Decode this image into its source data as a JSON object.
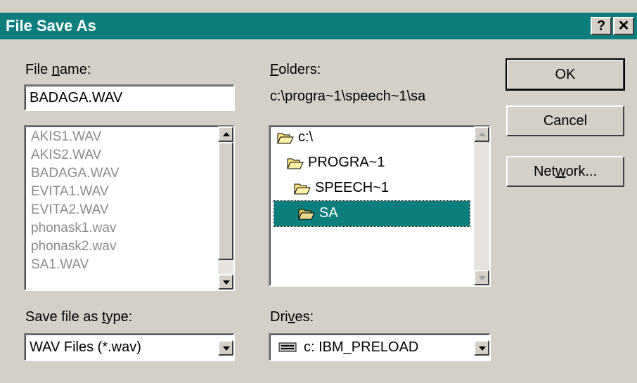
{
  "window": {
    "title": "File Save As",
    "help_label": "?",
    "close_label": "✕"
  },
  "file_name": {
    "label_pre": "File ",
    "label_u": "n",
    "label_post": "ame:",
    "value": "BADAGA.WAV"
  },
  "files": [
    "AKIS1.WAV",
    "AKIS2.WAV",
    "BADAGA.WAV",
    "EVITA1.WAV",
    "EVITA2.WAV",
    "phonask1.wav",
    "phonask2.wav",
    "SA1.WAV"
  ],
  "folders": {
    "label_u": "F",
    "label_post": "olders:",
    "path": "c:\\progra~1\\speech~1\\sa",
    "items": [
      {
        "name": "c:\\",
        "state": "open"
      },
      {
        "name": "PROGRA~1",
        "state": "open"
      },
      {
        "name": "SPEECH~1",
        "state": "open"
      },
      {
        "name": "SA",
        "state": "open-selected"
      }
    ]
  },
  "save_type": {
    "label_pre": "Save file as ",
    "label_u": "t",
    "label_post": "ype:",
    "value": "WAV Files (*.wav)"
  },
  "drives": {
    "label_pre": "Dri",
    "label_u": "v",
    "label_post": "es:",
    "value": "c: IBM_PRELOAD",
    "icon": "hard-drive-icon"
  },
  "buttons": {
    "ok": "OK",
    "cancel": "Cancel",
    "network_pre": "Net",
    "network_u": "w",
    "network_post": "ork..."
  },
  "colors": {
    "titlebar": "#0c7f7c",
    "selection": "#0c7f7c",
    "face": "#d4d0c8"
  }
}
